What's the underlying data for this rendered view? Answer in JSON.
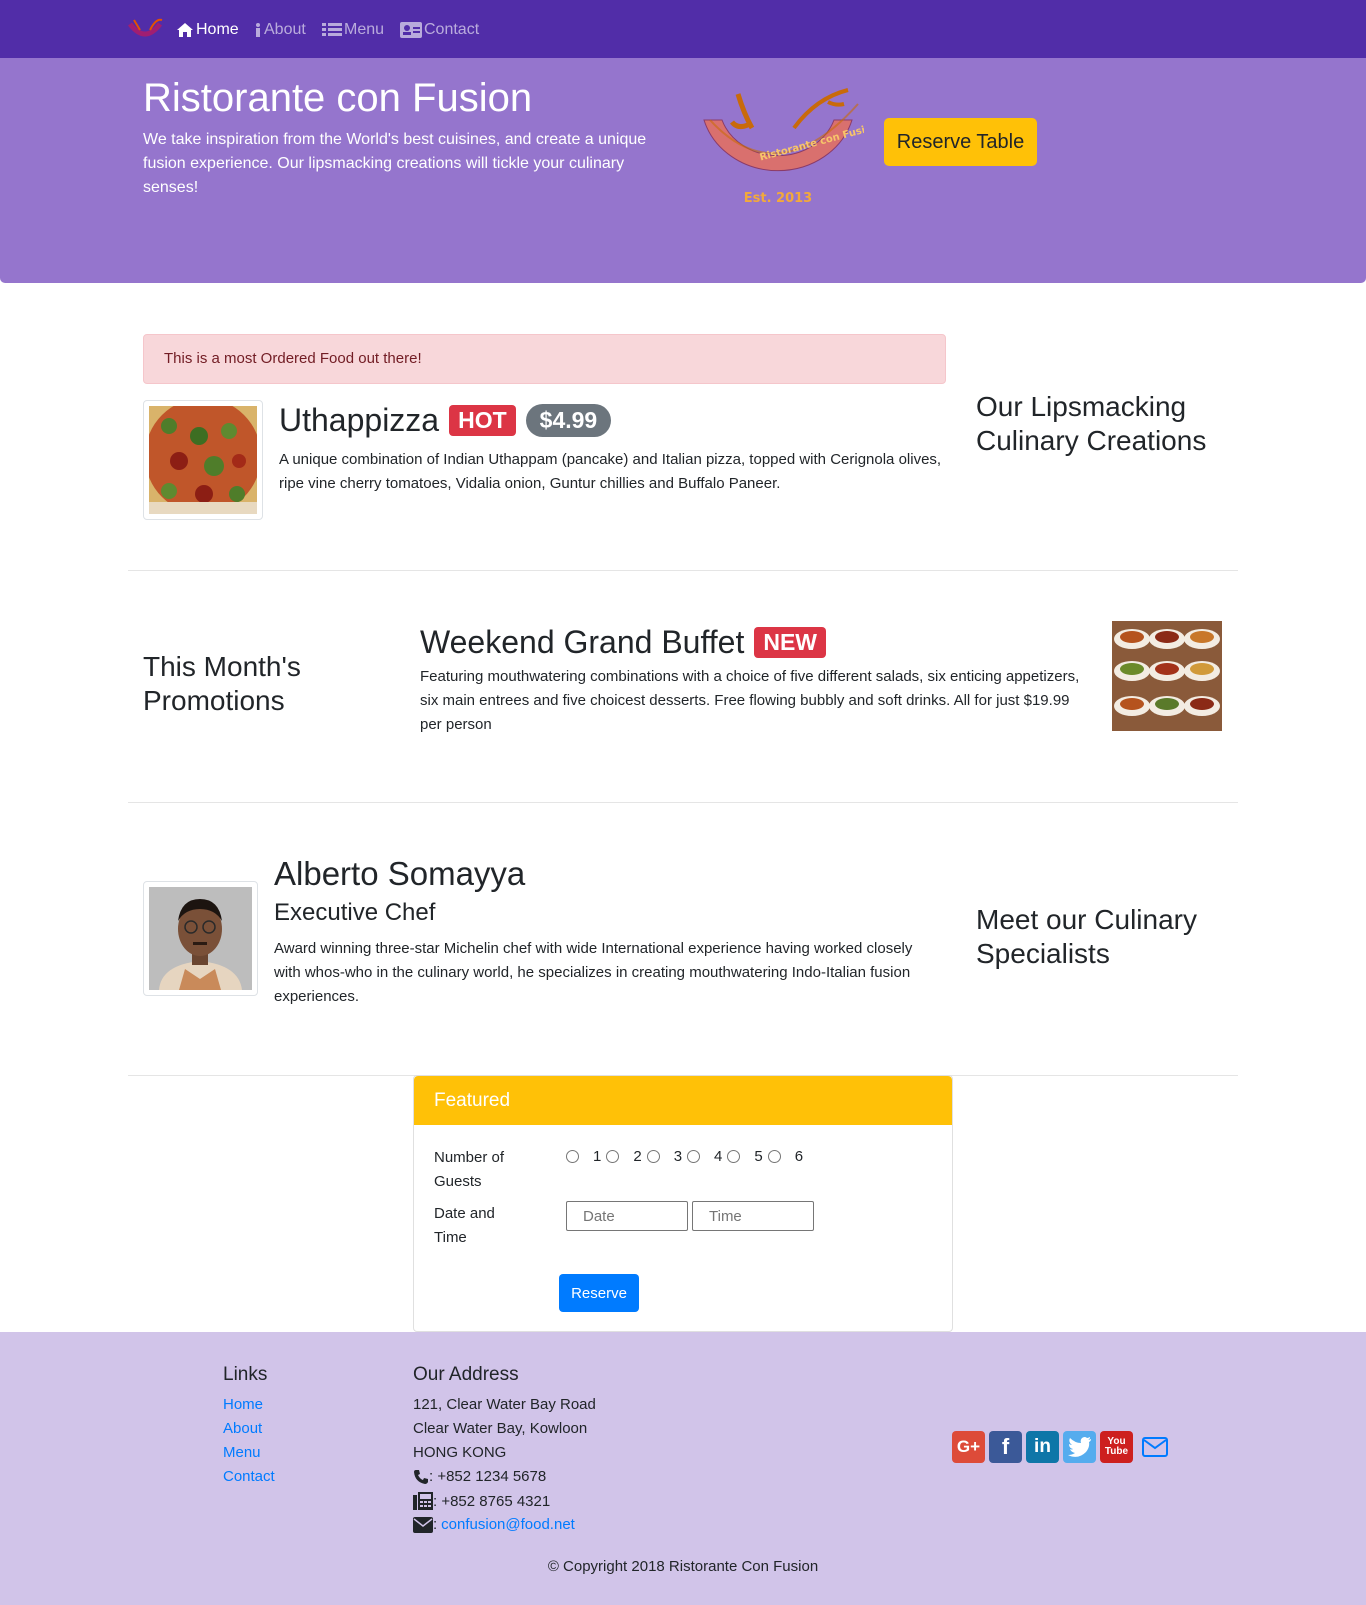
{
  "nav": {
    "items": [
      {
        "label": "Home",
        "icon": "home-icon",
        "active": true
      },
      {
        "label": "About",
        "icon": "info-icon",
        "active": false
      },
      {
        "label": "Menu",
        "icon": "list-icon",
        "active": false
      },
      {
        "label": "Contact",
        "icon": "address-card-icon",
        "active": false
      }
    ]
  },
  "jumbotron": {
    "title": "Ristorante con Fusion",
    "text": "We take inspiration from the World's best cuisines, and create a unique fusion experience. Our lipsmacking creations will tickle your culinary senses!",
    "reserve_label": "Reserve Table",
    "logo_text": "Ristorante con Fusion",
    "logo_est": "Est. 2013"
  },
  "alert": {
    "text": "This is a most Ordered Food out there!"
  },
  "dish": {
    "name": "Uthappizza",
    "badge": "HOT",
    "price": "$4.99",
    "description": "A unique combination of Indian Uthappam (pancake) and Italian pizza, topped with Cerignola olives, ripe vine cherry tomatoes, Vidalia onion, Guntur chillies and Buffalo Paneer."
  },
  "dish_side_title": "Our Lipsmacking Culinary Creations",
  "promotion": {
    "side_title": "This Month's Promotions",
    "name": "Weekend Grand Buffet",
    "badge": "NEW",
    "description": "Featuring mouthwatering combinations with a choice of five different salads, six enticing appetizers, six main entrees and five choicest desserts. Free flowing bubbly and soft drinks. All for just $19.99 per person"
  },
  "leader": {
    "name": "Alberto Somayya",
    "designation": "Executive Chef",
    "description": "Award winning three-star Michelin chef with wide International experience having worked closely with whos-who in the culinary world, he specializes in creating mouthwatering Indo-Italian fusion experiences.",
    "side_title": "Meet our Culinary Specialists"
  },
  "reservation": {
    "header": "Featured",
    "guests_label": "Number of Guests",
    "guest_options": [
      "1",
      "2",
      "3",
      "4",
      "5",
      "6"
    ],
    "datetime_label": "Date and Time",
    "date_placeholder": "Date",
    "time_placeholder": "Time",
    "submit_label": "Reserve"
  },
  "footer": {
    "links_heading": "Links",
    "links": [
      "Home",
      "About",
      "Menu",
      "Contact"
    ],
    "address_heading": "Our Address",
    "address_lines": [
      "121, Clear Water Bay Road",
      "Clear Water Bay, Kowloon",
      "HONG KONG"
    ],
    "phone": ": +852 1234 5678",
    "fax": ": +852 8765 4321",
    "email_prefix": ":",
    "email": "confusion@food.net",
    "social": [
      "google-plus-icon",
      "facebook-icon",
      "linkedin-icon",
      "twitter-icon",
      "youtube-icon",
      "envelope-icon"
    ],
    "copyright": "© Copyright 2018 Ristorante Con Fusion"
  },
  "colors": {
    "navbar": "#512DA8",
    "jumbotron": "#9575CD",
    "footer": "#D1C4E9",
    "accent": "#FFC107"
  }
}
